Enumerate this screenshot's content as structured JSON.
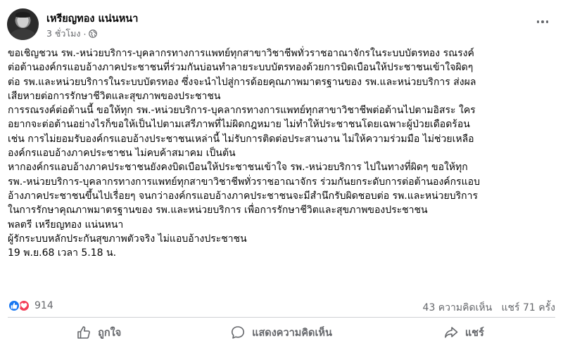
{
  "post": {
    "author": "เหรียญทอง แน่นหนา",
    "time": "3 ชั่วโมง",
    "privacy_separator": "·",
    "privacy_icon": "globe-icon",
    "more_icon": "more-options-icon",
    "body_lines": [
      "ขอเชิญชวน รพ.-หน่วยบริการ-บุคลากรทางการแพทย์ทุกสาขาวิชาชีพทั่วราชอาณาจักรในระบบบัตรทอง รณรงค์",
      "ต่อต้านองค์กรแอบอ้างภาคประชาชนที่ร่วมกันบ่อนทำลายระบบบัตรทองด้วยการบิดเบือนให้ประชาชนเข้าใจผิดๆ",
      "ต่อ รพ.และหน่วยบริการในระบบบัตรทอง ซึ่งจะนำไปสู่การด้อยคุณภาพมาตรฐานของ รพ.และหน่วยบริการ ส่งผล",
      "เสียหายต่อการรักษาชีวิตและสุขภาพของประชาชน",
      "การรณรงค์ต่อต้านนี้ ขอให้ทุก รพ.-หน่วยบริการ-บุคลากรทางการแพทย์ทุกสาขาวิชาชีพต่อต้านไปตามอิสระ ใคร",
      "อยากจะต่อต้านอย่างไรก็ขอให้เป็นไปตามเสรีภาพที่ไม่ผิดกฎหมาย ไม่ทำให้ประชาชนโดยเฉพาะผู้ป่วยเดือดร้อน",
      "เช่น การไม่ยอมรับองค์กรแอบอ้างประชาชนเหล่านี้ ไม่รับการติดต่อประสานงาน ไม่ให้ความร่วมมือ ไม่ช่วยเหลือ",
      "องค์กรแอบอ้างภาคประชาชน ไม่คบค้าสมาคม เป็นต้น",
      "หากองค์กรแอบอ้างภาคประชาชนยังคงบิดเบือนให้ประชาชนเข้าใจ รพ.-หน่วยบริการ ไปในทางที่ผิดๆ ขอให้ทุก",
      "รพ.-หน่วยบริการ-บุคลากรทางการแพทย์ทุกสาขาวิชาชีพทั่วราชอาณาจักร ร่วมกันยกระดับการต่อต้านองค์กรแอบ",
      "อ้างภาคประชาชนขึ้นไปเรื่อยๆ จนกว่าองค์กรแอบอ้างภาคประชาชนจะมีสำนึกรับผิดชอบต่อ รพ.และหน่วยบริการ",
      "ในการรักษาคุณภาพมาตรฐานของ รพ.และหน่วยบริการ เพื่อการรักษาชีวิตและสุขภาพของประชาชน",
      "พลตรี เหรียญทอง แน่นหนา",
      "ผู้รักระบบหลักประกันสุขภาพตัวจริง ไม่แอบอ้างประชาชน",
      "19 พ.ย.68 เวลา 5.18 น."
    ]
  },
  "stats": {
    "reaction_icons": [
      "like-reaction-icon",
      "love-reaction-icon"
    ],
    "reaction_count": "914",
    "comments": "43 ความคิดเห็น",
    "shares": "แชร์ 71 ครั้ง"
  },
  "actions": {
    "like_label": "ถูกใจ",
    "comment_label": "แสดงความคิดเห็น",
    "share_label": "แชร์"
  },
  "colors": {
    "text": "#050505",
    "secondary_text": "#65676b",
    "like_blue": "#1877f2",
    "love_red": "#f33e58",
    "divider": "#ced0d4"
  }
}
